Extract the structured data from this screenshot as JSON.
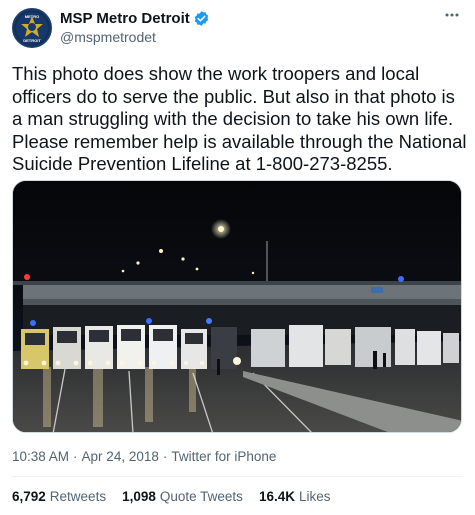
{
  "author": {
    "display_name": "MSP Metro Detroit",
    "handle": "@mspmetrodet",
    "avatar_text_top": "METRO",
    "avatar_text_bottom": "DETROIT",
    "verified_icon": "verified-badge-icon"
  },
  "more_icon": "more-options-icon",
  "tweet": {
    "text": "This photo does show the work troopers and local officers do to serve the public. But also in that photo is a man struggling with the decision to take his own life. Please remember help is available through the National Suicide Prevention Lifeline at 1-800-273-8255."
  },
  "meta": {
    "time": "10:38 AM",
    "separator": "·",
    "date": "Apr 24, 2018",
    "source": "Twitter for iPhone"
  },
  "stats": {
    "retweets_count": "6,792",
    "retweets_label": "Retweets",
    "quotes_count": "1,098",
    "quotes_label": "Quote Tweets",
    "likes_count": "16.4K",
    "likes_label": "Likes"
  },
  "colors": {
    "text": "#0f1419",
    "secondary": "#536471",
    "verified": "#1d9bf0",
    "border": "#cfd9de"
  }
}
